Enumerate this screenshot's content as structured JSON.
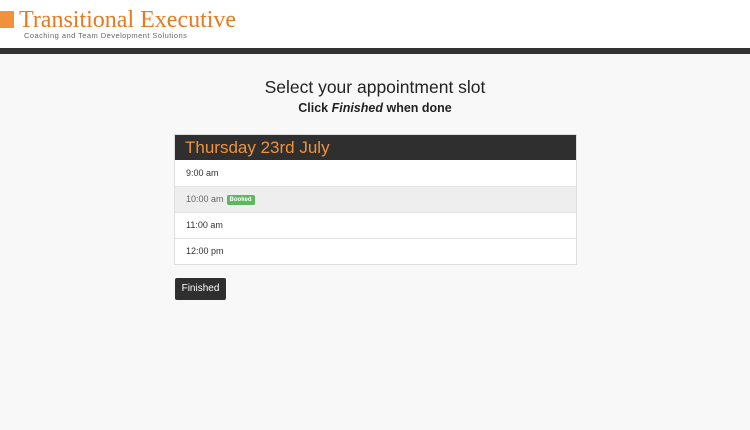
{
  "brand": {
    "name": "Transitional Executive",
    "tagline": "Coaching and Team Development Solutions",
    "accent_color": "#f0923c"
  },
  "page": {
    "title": "Select your appointment slot",
    "subtitle_prefix": "Click",
    "subtitle_emphasis": "Finished",
    "subtitle_suffix": "when done"
  },
  "schedule": {
    "day_label": "Thursday 23rd July",
    "slots": [
      {
        "time": "9:00 am",
        "status": ""
      },
      {
        "time": "10:00 am",
        "status": "Booked"
      },
      {
        "time": "11:00 am",
        "status": ""
      },
      {
        "time": "12:00 pm",
        "status": ""
      }
    ],
    "booked_badge_color": "#5cb85c"
  },
  "actions": {
    "finished_label": "Finished"
  }
}
